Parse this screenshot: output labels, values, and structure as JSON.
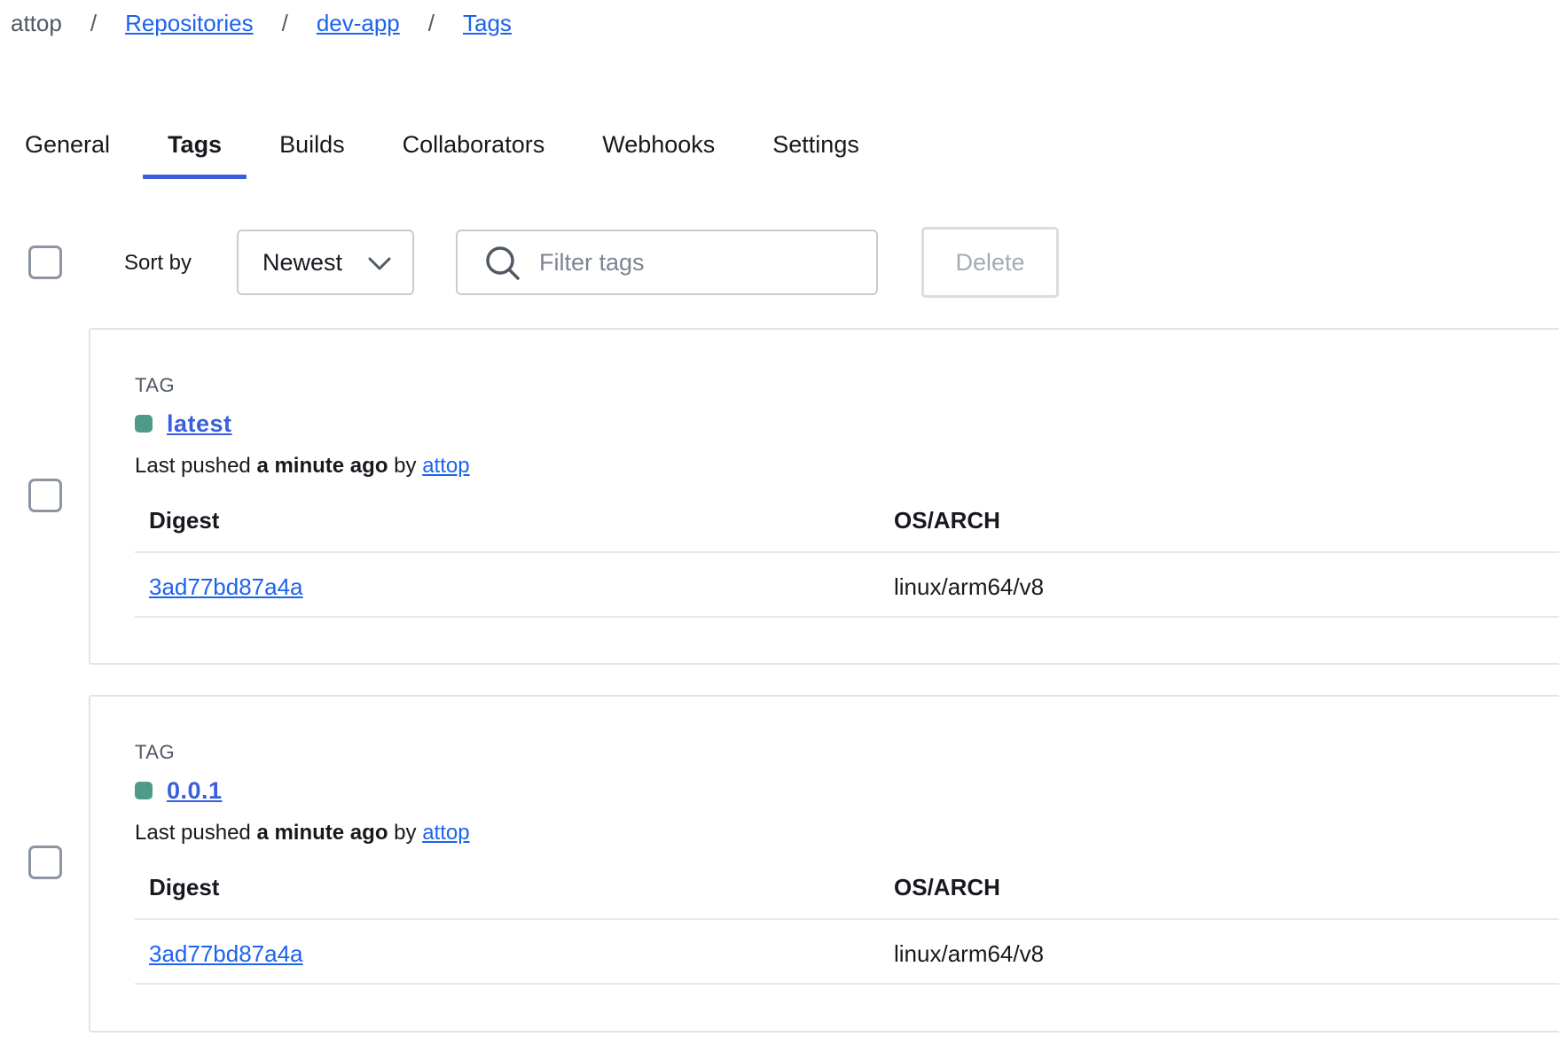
{
  "breadcrumb": {
    "root": "attop",
    "separator": "/",
    "links": [
      "Repositories",
      "dev-app",
      "Tags"
    ]
  },
  "tabs": [
    {
      "label": "General",
      "active": false
    },
    {
      "label": "Tags",
      "active": true
    },
    {
      "label": "Builds",
      "active": false
    },
    {
      "label": "Collaborators",
      "active": false
    },
    {
      "label": "Webhooks",
      "active": false
    },
    {
      "label": "Settings",
      "active": false
    }
  ],
  "toolbar": {
    "sort_label": "Sort by",
    "sort_value": "Newest",
    "filter_placeholder": "Filter tags",
    "delete_label": "Delete"
  },
  "tags": [
    {
      "section_label": "TAG",
      "name": "latest",
      "pushed_prefix": "Last pushed",
      "pushed_when": "a minute ago",
      "pushed_by_word": "by",
      "pushed_by": "attop",
      "digest_header": "Digest",
      "os_header": "OS/ARCH",
      "rows": [
        {
          "digest": "3ad77bd87a4a",
          "os_arch": "linux/arm64/v8"
        }
      ]
    },
    {
      "section_label": "TAG",
      "name": "0.0.1",
      "pushed_prefix": "Last pushed",
      "pushed_when": "a minute ago",
      "pushed_by_word": "by",
      "pushed_by": "attop",
      "digest_header": "Digest",
      "os_header": "OS/ARCH",
      "rows": [
        {
          "digest": "3ad77bd87a4a",
          "os_arch": "linux/arm64/v8"
        }
      ]
    }
  ],
  "colors": {
    "link": "#1d63ed",
    "tab_underline": "#3a5ede",
    "status_active": "#4f9b89"
  }
}
